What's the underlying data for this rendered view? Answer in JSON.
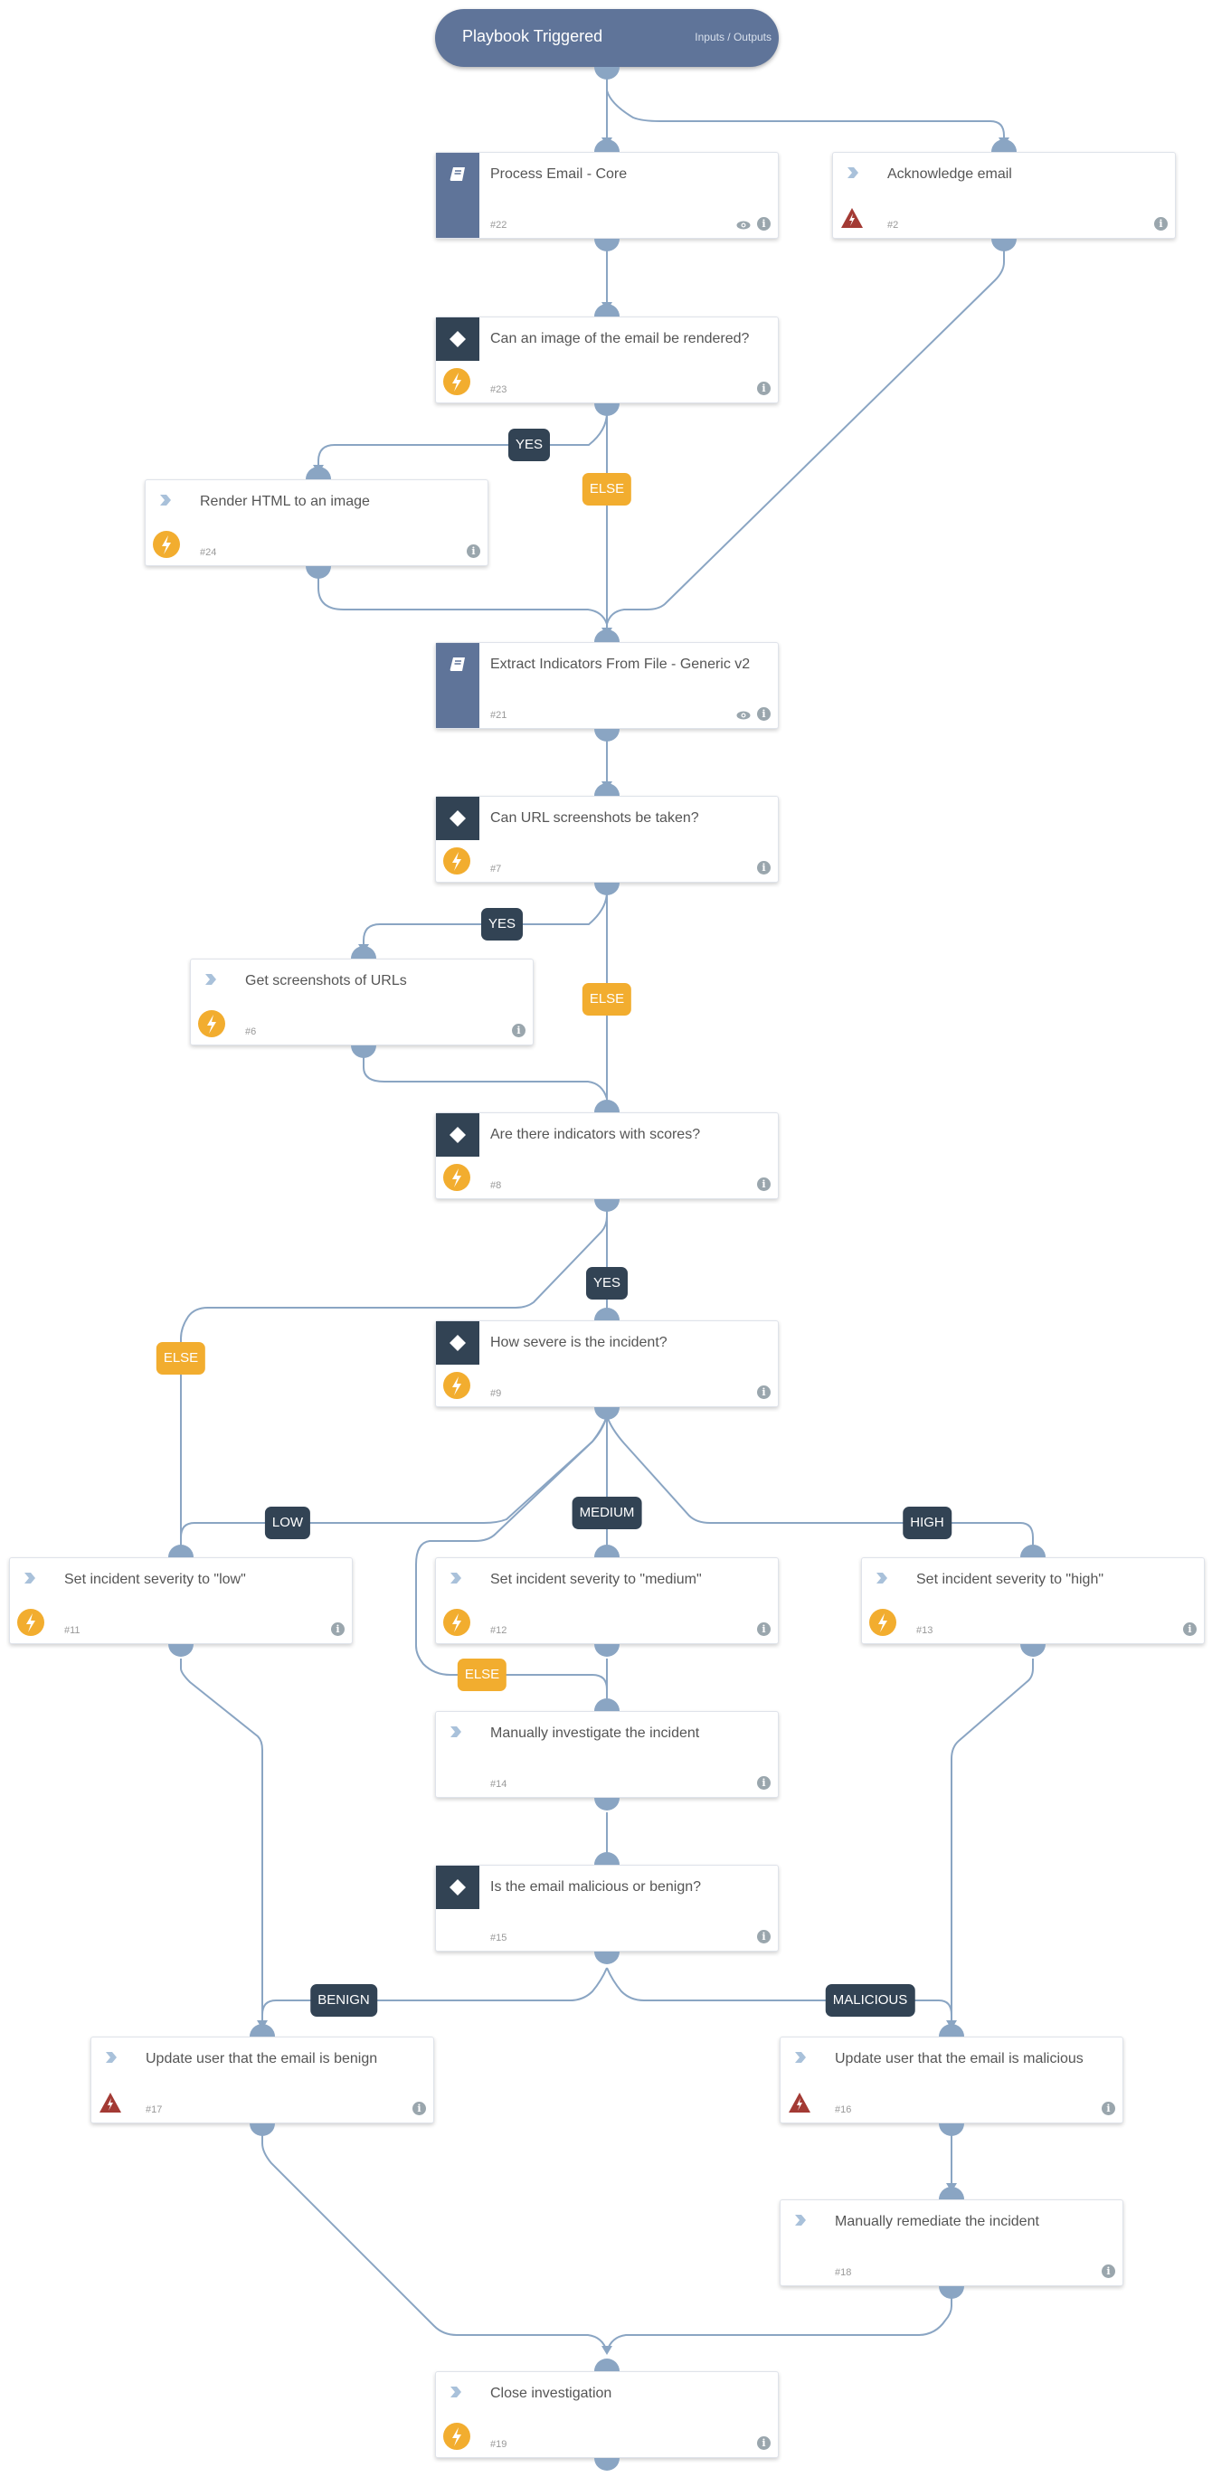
{
  "trigger": {
    "title": "Playbook Triggered",
    "io_link": "Inputs / Outputs"
  },
  "colors": {
    "connector": "#8aa5c3",
    "playbook_strip": "#5f7499",
    "condition_header": "#324354",
    "automation_badge": "#f2ad2f",
    "manual_warning": "#a33a34",
    "else_label": "#f2ad2f",
    "condition_label": "#324354"
  },
  "nodes": {
    "n22": {
      "title": "Process Email - Core",
      "id": "#22",
      "kind": "playbook",
      "icons": [
        "book-icon",
        "eye-icon",
        "info-icon"
      ]
    },
    "n2": {
      "title": "Acknowledge email",
      "id": "#2",
      "kind": "task",
      "badge": "warning",
      "icons": [
        "chevron-icon",
        "warning-icon",
        "info-icon"
      ]
    },
    "n23": {
      "title": "Can an image of the email be rendered?",
      "id": "#23",
      "kind": "condition",
      "badge": "automation"
    },
    "n24": {
      "title": "Render HTML to an image",
      "id": "#24",
      "kind": "task",
      "badge": "automation"
    },
    "n21": {
      "title": "Extract Indicators From File - Generic v2",
      "id": "#21",
      "kind": "playbook"
    },
    "n7": {
      "title": "Can URL screenshots be taken?",
      "id": "#7",
      "kind": "condition",
      "badge": "automation"
    },
    "n6": {
      "title": "Get screenshots of URLs",
      "id": "#6",
      "kind": "task",
      "badge": "automation"
    },
    "n8": {
      "title": "Are there indicators with scores?",
      "id": "#8",
      "kind": "condition",
      "badge": "automation"
    },
    "n9": {
      "title": "How severe is the incident?",
      "id": "#9",
      "kind": "condition",
      "badge": "automation"
    },
    "n11": {
      "title": "Set incident severity to \"low\"",
      "id": "#11",
      "kind": "task",
      "badge": "automation"
    },
    "n12": {
      "title": "Set incident severity to \"medium\"",
      "id": "#12",
      "kind": "task",
      "badge": "automation"
    },
    "n13": {
      "title": "Set incident severity to \"high\"",
      "id": "#13",
      "kind": "task",
      "badge": "automation"
    },
    "n14": {
      "title": "Manually investigate the incident",
      "id": "#14",
      "kind": "task"
    },
    "n15": {
      "title": "Is the email malicious or benign?",
      "id": "#15",
      "kind": "condition"
    },
    "n17": {
      "title": "Update user that the email is benign",
      "id": "#17",
      "kind": "task",
      "badge": "warning"
    },
    "n16": {
      "title": "Update user that the email is malicious",
      "id": "#16",
      "kind": "task",
      "badge": "warning"
    },
    "n18": {
      "title": "Manually remediate the incident",
      "id": "#18",
      "kind": "task"
    },
    "n19": {
      "title": "Close investigation",
      "id": "#19",
      "kind": "task",
      "badge": "automation"
    }
  },
  "labels": {
    "yes1": "YES",
    "else1": "ELSE",
    "yes2": "YES",
    "else2": "ELSE",
    "yes3": "YES",
    "else3": "ELSE",
    "low": "LOW",
    "medium": "MEDIUM",
    "high": "HIGH",
    "else4": "ELSE",
    "benign": "BENIGN",
    "malicious": "MALICIOUS"
  },
  "info_glyph": "i"
}
